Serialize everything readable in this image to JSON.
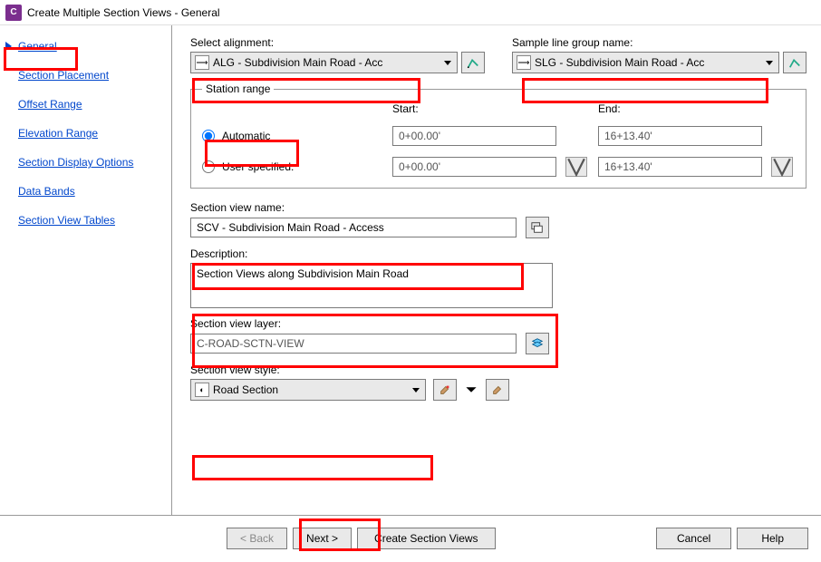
{
  "window": {
    "title": "Create Multiple Section Views - General",
    "icon_letter": "C"
  },
  "nav": [
    {
      "label": "General",
      "active": true
    },
    {
      "label": "Section Placement"
    },
    {
      "label": "Offset Range"
    },
    {
      "label": "Elevation Range"
    },
    {
      "label": "Section Display Options"
    },
    {
      "label": "Data Bands"
    },
    {
      "label": "Section View Tables"
    }
  ],
  "alignment": {
    "label": "Select alignment:",
    "value": "ALG - Subdivision Main Road - Acc"
  },
  "sample_line": {
    "label": "Sample line group name:",
    "value": "SLG - Subdivision Main Road - Acc"
  },
  "station": {
    "legend": "Station range",
    "automatic_label": "Automatic",
    "user_label": "User specified:",
    "start_label": "Start:",
    "end_label": "End:",
    "start_auto": "0+00.00'",
    "end_auto": "16+13.40'",
    "start_user": "0+00.00'",
    "end_user": "16+13.40'"
  },
  "sv_name": {
    "label": "Section view name:",
    "value": "SCV - Subdivision Main Road - Access"
  },
  "description": {
    "label": "Description:",
    "value": "Section Views along Subdivision Main Road"
  },
  "layer": {
    "label": "Section view layer:",
    "value": "C-ROAD-SCTN-VIEW"
  },
  "style": {
    "label": "Section view style:",
    "value": "Road Section"
  },
  "buttons": {
    "back": "< Back",
    "next": "Next >",
    "create": "Create Section Views",
    "cancel": "Cancel",
    "help": "Help"
  }
}
